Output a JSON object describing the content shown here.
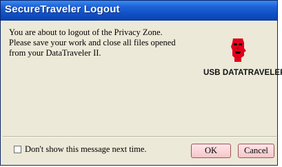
{
  "window": {
    "title": "SecureTraveler Logout"
  },
  "message": {
    "lines": [
      "You are about to logout of the Privacy Zone.",
      "Please save your work and close all files opened",
      "from your DataTraveler II."
    ]
  },
  "logo": {
    "text": "USB DATATRAVELER",
    "icon": "kingston-head-logo-icon",
    "color": "#e0001b"
  },
  "footer": {
    "checkbox_label": "Don't show this message next time.",
    "checkbox_checked": false,
    "ok_label": "OK",
    "cancel_label": "Cancel"
  },
  "colors": {
    "title_bar": "#1f63d8",
    "dialog_bg": "#ece9d8",
    "button_bg": "#f6c6ca",
    "button_border": "#a0525a"
  }
}
